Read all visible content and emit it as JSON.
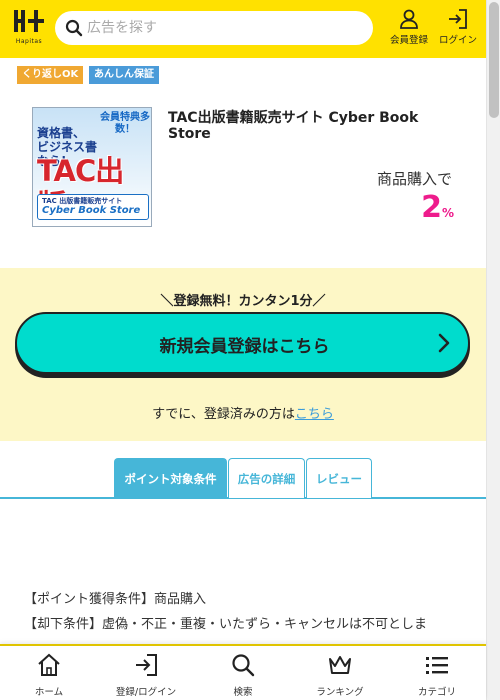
{
  "header": {
    "logo_text": "Hapitas",
    "search_placeholder": "広告を探す",
    "register_label": "会員登録",
    "login_label": "ログイン"
  },
  "badges": [
    "くり返しOK",
    "あんしん保証"
  ],
  "shop": {
    "name": "TAC出版書籍販売サイト Cyber Book Store",
    "banner": {
      "bonus": "会員特典多数！",
      "line1": "資格書、",
      "line2": "ビジネス書なら!",
      "title": "TAC出版",
      "sub": "TAC 出版書籍販売サイト",
      "logo": "Cyber Book Store"
    },
    "condition_label": "商品購入で",
    "rate_value": "2",
    "rate_unit": "%"
  },
  "register": {
    "tagline": "＼登録無料！カンタン1分／",
    "button_label": "新規会員登録はこちら",
    "already_text": "すでに、登録済みの方は",
    "already_link": "こちら"
  },
  "tabs": [
    "ポイント対象条件",
    "広告の詳細",
    "レビュー"
  ],
  "conditions": {
    "point_condition": "【ポイント獲得条件】商品購入",
    "reject_condition": "【却下条件】虚偽・不正・重複・いたずら・キャンセルは不可としま"
  },
  "bottom_nav": [
    "ホーム",
    "登録/ログイン",
    "検索",
    "ランキング",
    "カテゴリ"
  ],
  "colors": {
    "header_bg": "#ffe100",
    "accent_cyan": "#00dccd",
    "tab_blue": "#46b6d8",
    "rate_pink": "#ee1c8c",
    "register_bg": "#fdf7c6"
  }
}
